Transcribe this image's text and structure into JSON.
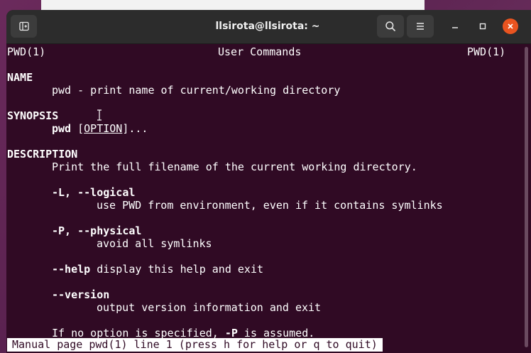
{
  "window": {
    "title": "llsirota@llsirota: ~"
  },
  "icons": {
    "new_tab": "new-tab-icon",
    "search": "search-icon",
    "menu": "hamburger-menu-icon",
    "minimize": "minimize-icon",
    "maximize": "maximize-icon",
    "close": "close-icon"
  },
  "colors": {
    "terminal_bg": "#300a24",
    "titlebar_bg": "#2c2c2c",
    "close_accent": "#e95420",
    "text": "#ffffff"
  },
  "man": {
    "header_left": "PWD(1)",
    "header_center": "User Commands",
    "header_right": "PWD(1)",
    "name_heading": "NAME",
    "name_text": "pwd - print name of current/working directory",
    "synopsis_heading": "SYNOPSIS",
    "synopsis_cmd": "pwd",
    "synopsis_open": "[",
    "synopsis_option": "OPTION",
    "synopsis_close": "]...",
    "description_heading": "DESCRIPTION",
    "description_text": "Print the full filename of the current working directory.",
    "opt_logical": "-L, --logical",
    "opt_logical_desc": "use PWD from environment, even if it contains symlinks",
    "opt_physical": "-P, --physical",
    "opt_physical_desc": "avoid all symlinks",
    "opt_help": "--help",
    "opt_help_desc": " display this help and exit",
    "opt_version": "--version",
    "opt_version_desc": "output version information and exit",
    "default_prefix": "If no option is specified, ",
    "default_opt": "-P",
    "default_suffix": " is assumed."
  },
  "status": {
    "text": "Manual page pwd(1) line 1 (press h for help or q to quit)"
  }
}
